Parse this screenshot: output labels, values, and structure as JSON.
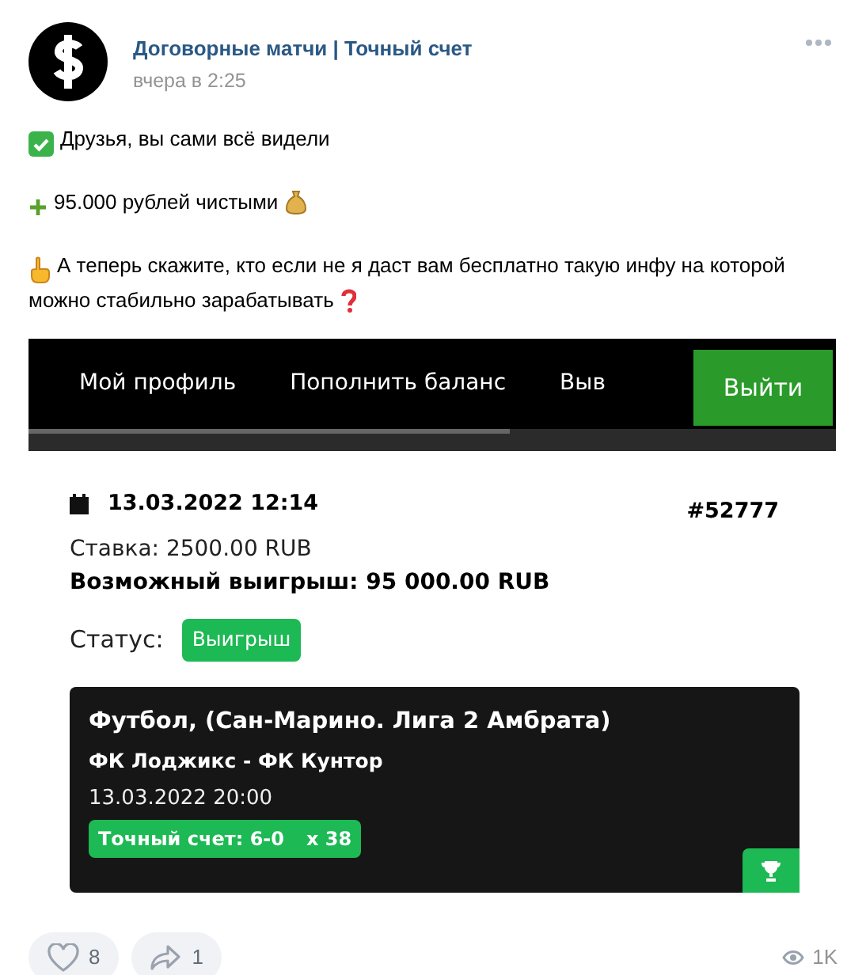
{
  "post": {
    "author": "Договорные матчи | Точный счет",
    "time": "вчера в 2:25",
    "paragraphs": [
      {
        "kind": "check",
        "lines": [
          "Друзья, вы сами всё видели"
        ]
      },
      {
        "kind": "plus",
        "lines": [
          "95.000 рублей чистыми"
        ]
      },
      {
        "kind": "finger",
        "lines": [
          "А теперь скажите, кто если не я даст вам бесплатно такую инфу на которой",
          "можно стабильно зарабатывать"
        ]
      }
    ]
  },
  "screenshot": {
    "nav": [
      {
        "label": "Мой профиль"
      },
      {
        "label": "Пополнить баланс"
      },
      {
        "label": "Выв"
      }
    ],
    "logout": "Выйти",
    "bet": {
      "date": "13.03.2022 12:14",
      "number": "#52777",
      "stake": "Ставка: 2500.00 RUB",
      "payout": "Возможный выигрыш: 95 000.00 RUB",
      "status_label": "Статус:",
      "status": "Выигрыш",
      "event": {
        "league": "Футбол, (Сан-Марино. Лига 2 Амбрата)",
        "teams": "ФК Лоджикс - ФК Кунтор",
        "datetime": "13.03.2022 20:00",
        "pick": "Точный счет: 6-0",
        "odds": "x 38"
      }
    }
  },
  "footer": {
    "likes": "8",
    "shares": "1",
    "views": "1K"
  }
}
